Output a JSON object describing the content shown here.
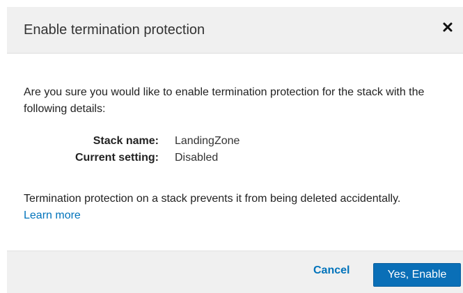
{
  "dialog": {
    "title": "Enable termination protection",
    "close_icon": "close-icon",
    "intro": "Are you sure you would like to enable termination protection for the stack with the following details:",
    "details": [
      {
        "key": "Stack name:",
        "value": "LandingZone"
      },
      {
        "key": "Current setting:",
        "value": "Disabled"
      }
    ],
    "note": "Termination protection on a stack prevents it from being deleted accidentally.",
    "learn_more": "Learn more",
    "cancel_label": "Cancel",
    "confirm_label": "Yes, Enable"
  },
  "colors": {
    "header_bg": "#f0f0f0",
    "link": "#0073bb",
    "primary": "#0a6fb7"
  }
}
